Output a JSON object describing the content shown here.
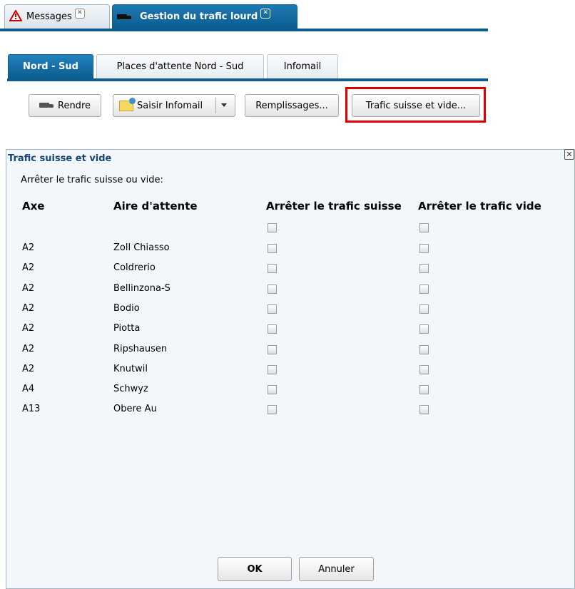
{
  "top_tabs": [
    {
      "label": "Messages",
      "icon": "warning-icon"
    },
    {
      "label": "Gestion du trafic lourd",
      "icon": "truck-icon"
    }
  ],
  "sub_tabs": [
    {
      "label": "Nord - Sud",
      "active": true
    },
    {
      "label": "Places d'attente Nord - Sud",
      "active": false
    },
    {
      "label": "Infomail",
      "active": false
    }
  ],
  "toolbar": {
    "rendre": "Rendre",
    "saisir_infomail": "Saisir Infomail",
    "remplissages": "Remplissages...",
    "trafic_suisse_vide": "Trafic suisse et vide..."
  },
  "dialog": {
    "title": "Trafic suisse et vide",
    "subtitle": "Arrêter le trafic suisse ou vide:",
    "columns": {
      "axe": "Axe",
      "aire": "Aire d'attente",
      "suisse": "Arrêter le trafic suisse",
      "vide": "Arrêter le trafic vide"
    },
    "rows": [
      {
        "axe": "A2",
        "aire": "Zoll Chiasso",
        "suisse": false,
        "vide": false
      },
      {
        "axe": "A2",
        "aire": "Coldrerio",
        "suisse": false,
        "vide": false
      },
      {
        "axe": "A2",
        "aire": "Bellinzona-S",
        "suisse": false,
        "vide": false
      },
      {
        "axe": "A2",
        "aire": "Bodio",
        "suisse": false,
        "vide": false
      },
      {
        "axe": "A2",
        "aire": "Piotta",
        "suisse": false,
        "vide": false
      },
      {
        "axe": "A2",
        "aire": "Ripshausen",
        "suisse": false,
        "vide": false
      },
      {
        "axe": "A2",
        "aire": "Knutwil",
        "suisse": false,
        "vide": false
      },
      {
        "axe": "A4",
        "aire": "Schwyz",
        "suisse": false,
        "vide": false
      },
      {
        "axe": "A13",
        "aire": "Obere Au",
        "suisse": false,
        "vide": false
      }
    ],
    "ok": "OK",
    "cancel": "Annuler"
  },
  "colors": {
    "accent": "#0b5c8f",
    "highlight": "#e00000",
    "title": "#15467a"
  }
}
